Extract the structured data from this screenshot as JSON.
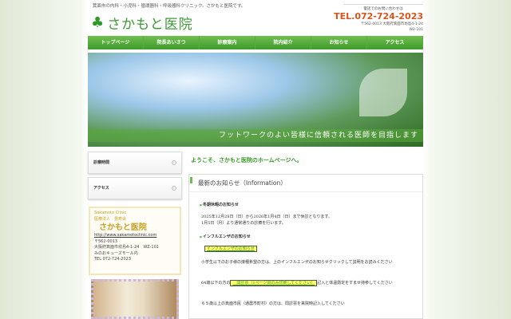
{
  "header": {
    "tagline": "箕面市の内科・小児科・循環器科・呼吸器科クリニック。さかもと医院です。",
    "logo_text": "さかもと医院",
    "contact_label": "電話でのお問い合わせは",
    "tel": "TEL.072-724-2023",
    "address_line1": "〒562-0013 大阪府箕面市坊島4-1-24",
    "address_line2": "W2-101"
  },
  "nav": [
    "トップページ",
    "院長あいさつ",
    "診療案内",
    "院内紹介",
    "お知らせ",
    "アクセス"
  ],
  "banner": {
    "caption": "フットワークのよい皆様に信頼される医師を目指します"
  },
  "sidebar": {
    "items": [
      "診療時間",
      "アクセス"
    ],
    "clinic": {
      "en": "Sakamoto Clinic",
      "corp": "医療法人　豊寿会",
      "name": "さかもと医院",
      "url": "http://www.sakamotoclinic.com",
      "zip": "〒562-0013",
      "address": "大阪府箕面市坊島4-1-24　WZ-101",
      "building": "みのおキューズモール内",
      "tel": "TEL 072-724-2023"
    }
  },
  "main": {
    "welcome": "ようこそ、さかもと医院のホームページへ。",
    "info_title": "最新のお知らせ（Information）",
    "notice1_title": "冬期休暇のお知らせ",
    "notice1_line1": "2025年12月28日（日）から2026年1月4日（日）まで休診となります。",
    "notice1_line2": "1月5日（月）より通常通りの診療を行います。",
    "notice2_title": "インフルエンザのお知らせ",
    "notice2_link": "インフルエンザのお知らせ",
    "notice2_text": "小学生以下のお子様の接種希望の方は、上のインフルエンザのお知らせクリックして説明をお読みください",
    "notice2_pre": "64歳以下の方の",
    "notice2_link2": "　問診票（1ページ目のみ印刷してください）",
    "notice2_post": "記入と体温測定をすませ持参してください",
    "notice2_last": "６５歳以上の箕面市民（通農市町村）の方は、問診票を来院時記入してください"
  }
}
